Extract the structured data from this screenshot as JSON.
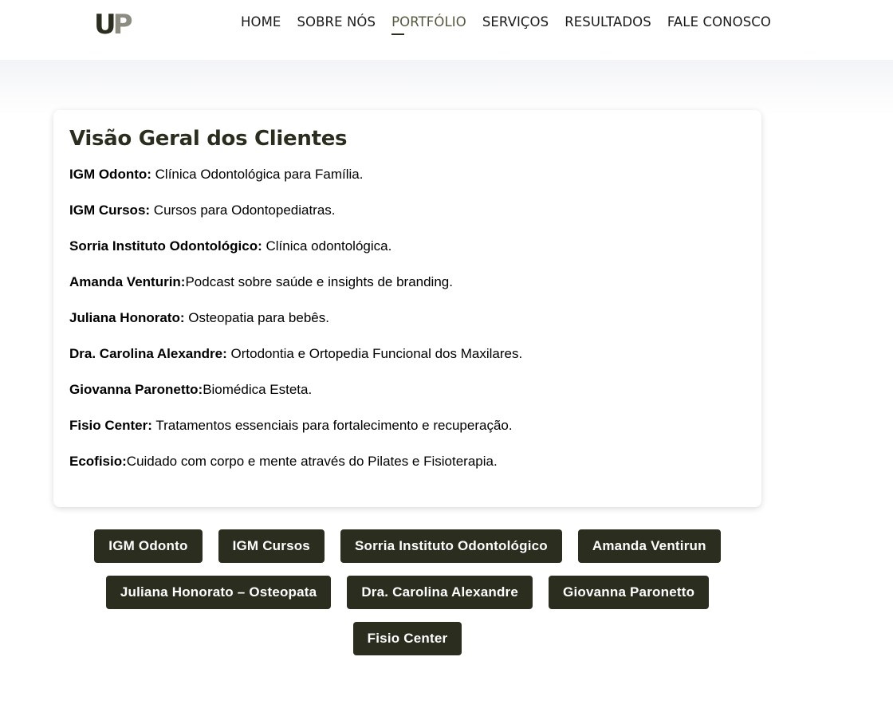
{
  "header": {
    "logo": {
      "first": "U",
      "second": "P"
    },
    "nav": [
      {
        "label": "HOME"
      },
      {
        "label": "SOBRE NÓS"
      },
      {
        "label": "PORTFÓLIO"
      },
      {
        "label": "SERVIÇOS"
      },
      {
        "label": "RESULTADOS"
      },
      {
        "label": "FALE CONOSCO"
      }
    ]
  },
  "overview": {
    "title": "Visão Geral dos Clientes",
    "clients": [
      {
        "name": "IGM Odonto:",
        "description": " Clínica Odontológica para Família."
      },
      {
        "name": "IGM Cursos:",
        "description": " Cursos para Odontopediatras."
      },
      {
        "name": "Sorria Instituto Odontológico:",
        "description": " Clínica odontológica."
      },
      {
        "name": "Amanda Venturin:",
        "description": "Podcast sobre saúde e insights de branding."
      },
      {
        "name": "Juliana Honorato:",
        "description": " Osteopatia para bebês."
      },
      {
        "name": "Dra. Carolina Alexandre:",
        "description": " Ortodontia e Ortopedia Funcional dos Maxilares."
      },
      {
        "name": "Giovanna Paronetto:",
        "description": "Biomédica Esteta."
      },
      {
        "name": "Fisio Center:",
        "description": " Tratamentos essenciais para fortalecimento e recuperação."
      },
      {
        "name": "Ecofisio:",
        "description": "Cuidado com corpo e mente através do Pilates e Fisioterapia."
      }
    ]
  },
  "buttons": [
    {
      "label": "IGM Odonto"
    },
    {
      "label": "IGM Cursos"
    },
    {
      "label": "Sorria Instituto Odontológico"
    },
    {
      "label": "Amanda Ventirun"
    },
    {
      "label": "Juliana Honorato – Osteopata"
    },
    {
      "label": "Dra. Carolina Alexandre"
    },
    {
      "label": "Giovanna Paronetto"
    },
    {
      "label": "Fisio Center"
    }
  ],
  "colors": {
    "brand_dark": "#2b2d1f",
    "brand_light": "#8c8d80"
  }
}
